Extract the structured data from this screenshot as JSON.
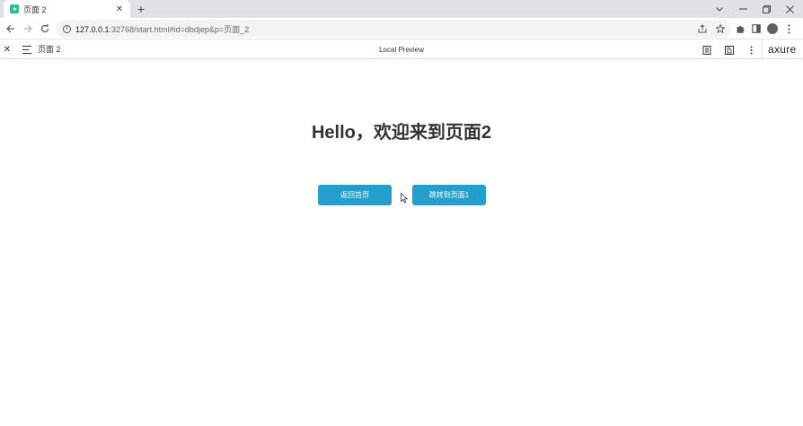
{
  "browser": {
    "tab_title": "页面 2",
    "tab_close": "✕",
    "new_tab": "+",
    "url_host": "127.0.0.1",
    "url_rest": ":32768/start.html#id=dbdjep&p=页面_2"
  },
  "axure_bar": {
    "close": "✕",
    "page_name": "页面 2",
    "center_label": "Local Preview",
    "logo": "axure"
  },
  "page": {
    "heading": "Hello，欢迎来到页面2",
    "buttons": {
      "back_home": "返回首页",
      "go_page1": "跳转到页面1"
    }
  },
  "colors": {
    "button_bg": "#239fcd",
    "favicon": "#23c38e"
  },
  "icons": [
    "favicon-icon",
    "close-icon",
    "plus-icon",
    "chevron-down-icon",
    "minimize-icon",
    "maximize-icon",
    "back-icon",
    "forward-icon",
    "reload-icon",
    "info-icon",
    "share-icon",
    "star-icon",
    "puzzle-icon",
    "sidepanel-icon",
    "profile-icon",
    "more-icon",
    "hamburger-icon",
    "notes-icon",
    "inspect-icon",
    "cursor-icon"
  ]
}
